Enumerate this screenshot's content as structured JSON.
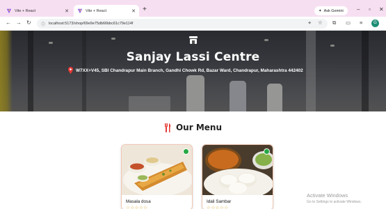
{
  "browser": {
    "tabs": [
      {
        "label": "Vite + React",
        "active": false
      },
      {
        "label": "Vite + React",
        "active": true
      }
    ],
    "new_tab_symbol": "+",
    "ask_gemini": "Ask Gemini",
    "url": "localhost:5173/shop/69e9e75db66bbc61c79e114f",
    "window_controls": {
      "minimize": "–",
      "maximize": "▫",
      "close": "✕"
    },
    "profile_initial": "G"
  },
  "hero": {
    "shop_name": "Sanjay Lassi Centre",
    "address": "W7XX+V45, SBI Chandrapur Main Branch, Gandhi Chowk Rd, Bazar Ward, Chandrapur, Maharashtra 442402"
  },
  "menu": {
    "heading": "Our Menu",
    "items": [
      {
        "name": "Masala dosa",
        "rating_display": "☆☆☆☆☆"
      },
      {
        "name": "Idali Sambar",
        "rating_display": "☆☆☆☆☆"
      }
    ]
  },
  "watermark": {
    "line1": "Activate Windows",
    "line2": "Go to Settings to activate Windows."
  },
  "colors": {
    "tab_strip": "#f7dff2",
    "card_border": "#f0c7b3",
    "veg_badge": "#27a844",
    "star": "#d9a520",
    "pin": "#e53935",
    "fork_icon": "#e53935"
  }
}
